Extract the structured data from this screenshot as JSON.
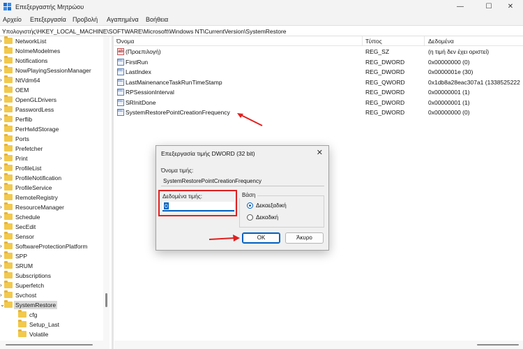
{
  "window": {
    "title": "Επεξεργαστής Μητρώου",
    "minimize_glyph": "—",
    "maximize_glyph": "☐",
    "close_glyph": "✕"
  },
  "menu": [
    "Αρχείο",
    "Επεξεργασία",
    "Προβολή",
    "Αγαπημένα",
    "Βοήθεια"
  ],
  "address": "Υπολογιστής\\HKEY_LOCAL_MACHINE\\SOFTWARE\\Microsoft\\Windows NT\\CurrentVersion\\SystemRestore",
  "tree": {
    "items": [
      {
        "label": "NetworkList",
        "expandable": true
      },
      {
        "label": "NoImeModelmes",
        "expandable": false
      },
      {
        "label": "Notifications",
        "expandable": true
      },
      {
        "label": "NowPlayingSessionManager",
        "expandable": true
      },
      {
        "label": "NtVdm64",
        "expandable": true
      },
      {
        "label": "OEM",
        "expandable": false
      },
      {
        "label": "OpenGLDrivers",
        "expandable": true
      },
      {
        "label": "PasswordLess",
        "expandable": true
      },
      {
        "label": "Perflib",
        "expandable": true
      },
      {
        "label": "PerHwIdStorage",
        "expandable": false
      },
      {
        "label": "Ports",
        "expandable": false
      },
      {
        "label": "Prefetcher",
        "expandable": false
      },
      {
        "label": "Print",
        "expandable": true
      },
      {
        "label": "ProfileList",
        "expandable": true
      },
      {
        "label": "ProfileNotification",
        "expandable": true
      },
      {
        "label": "ProfileService",
        "expandable": true
      },
      {
        "label": "RemoteRegistry",
        "expandable": false
      },
      {
        "label": "ResourceManager",
        "expandable": true
      },
      {
        "label": "Schedule",
        "expandable": true
      },
      {
        "label": "SecEdit",
        "expandable": false
      },
      {
        "label": "Sensor",
        "expandable": true
      },
      {
        "label": "SoftwareProtectionPlatform",
        "expandable": true
      },
      {
        "label": "SPP",
        "expandable": true
      },
      {
        "label": "SRUM",
        "expandable": true
      },
      {
        "label": "Subscriptions",
        "expandable": false
      },
      {
        "label": "Superfetch",
        "expandable": true
      },
      {
        "label": "Svchost",
        "expandable": true
      },
      {
        "label": "SystemRestore",
        "expandable": true,
        "expanded": true,
        "selected": true
      },
      {
        "label": "cfg",
        "child": true
      },
      {
        "label": "Setup_Last",
        "child": true
      },
      {
        "label": "Volatile",
        "child": true
      }
    ]
  },
  "list": {
    "columns": [
      "Όνομα",
      "Τύπος",
      "Δεδομένα"
    ],
    "rows": [
      {
        "icon": "string-value-icon",
        "glyph": "ab",
        "name": "(Προεπιλογή)",
        "type": "REG_SZ",
        "data": "(η τιμή δεν έχει οριστεί)"
      },
      {
        "icon": "binary-value-icon",
        "glyph": "011 110",
        "name": "FirstRun",
        "type": "REG_DWORD",
        "data": "0x00000000 (0)"
      },
      {
        "icon": "binary-value-icon",
        "glyph": "011 110",
        "name": "LastIndex",
        "type": "REG_DWORD",
        "data": "0x0000001e (30)"
      },
      {
        "icon": "binary-value-icon",
        "glyph": "011 110",
        "name": "LastMainenanceTaskRunTimeStamp",
        "type": "REG_QWORD",
        "data": "0x1db8a28eac307a1 (1338525222"
      },
      {
        "icon": "binary-value-icon",
        "glyph": "011 110",
        "name": "RPSessionInterval",
        "type": "REG_DWORD",
        "data": "0x00000001 (1)"
      },
      {
        "icon": "binary-value-icon",
        "glyph": "011 110",
        "name": "SRInitDone",
        "type": "REG_DWORD",
        "data": "0x00000001 (1)"
      },
      {
        "icon": "binary-value-icon",
        "glyph": "011 110",
        "name": "SystemRestorePointCreationFrequency",
        "type": "REG_DWORD",
        "data": "0x00000000 (0)"
      }
    ]
  },
  "dialog": {
    "title": "Επεξεργασία τιμής DWORD (32 bit)",
    "close_glyph": "✕",
    "value_name_label": "Όνομα τιμής:",
    "value_name": "SystemRestorePointCreationFrequency",
    "value_data_label": "Δεδομένα τιμής:",
    "value_data": "0",
    "base_label": "Βάση",
    "base_options": [
      {
        "label": "Δεκαεξαδική",
        "checked": true
      },
      {
        "label": "Δεκαδική",
        "checked": false
      }
    ],
    "ok_label": "OK",
    "cancel_label": "Άκυρο"
  },
  "annotation_color": "#e02020",
  "accent_color": "#0060c0"
}
